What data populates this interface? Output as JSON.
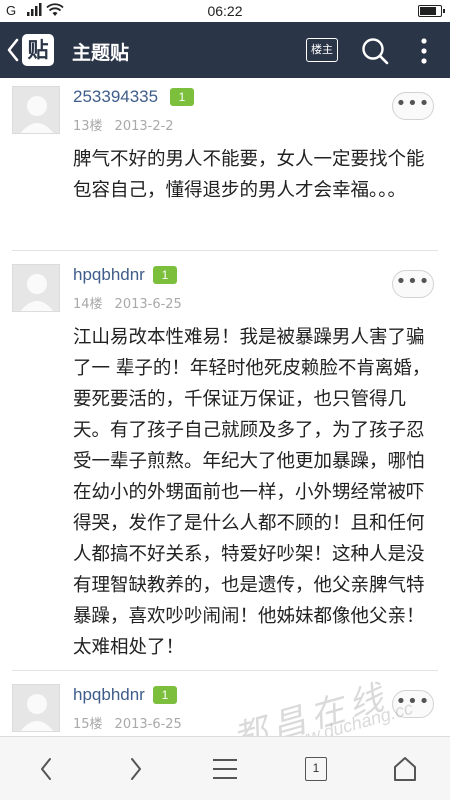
{
  "status_bar": {
    "carrier_text": "G",
    "time": "06:22"
  },
  "header": {
    "back_icon_text": "贴",
    "title": "主题贴",
    "louzhu_label": "楼主"
  },
  "posts": [
    {
      "username": "253394335",
      "level": "1",
      "floor": "13楼",
      "date": "2013-2-2",
      "more": "•••",
      "text": "脾气不好的男人不能要，女人一定要找个能包容自己，懂得退步的男人才会幸福。。。"
    },
    {
      "username": "hpqbhdnr",
      "level": "1",
      "floor": "14楼",
      "date": "2013-6-25",
      "more": "•••",
      "text": "江山易改本性难易！我是被暴躁男人害了骗了一 辈子的！年轻时他死皮赖脸不肯离婚，要死要活的，千保证万保证，也只管得几天。有了孩子自己就顾及多了，为了孩子忍受一辈子煎熬。年纪大了他更加暴躁，哪怕在幼小的外甥面前也一样，小外甥经常被吓得哭，发作了是什么人都不顾的！且和任何人都搞不好关系，特爱好吵架！这种人是没有理智缺教养的，也是遗传，他父亲脾气特暴躁，喜欢吵吵闹闹！他姊妹都像他父亲！太难相处了！"
    },
    {
      "username": "hpqbhdnr",
      "level": "1",
      "floor": "15楼",
      "date": "2013-6-25",
      "more": "•••",
      "text": ""
    }
  ],
  "watermark": {
    "text": "都昌在线",
    "url": "www.duchang.cc"
  },
  "bottom_bar": {
    "page_number": "1"
  }
}
